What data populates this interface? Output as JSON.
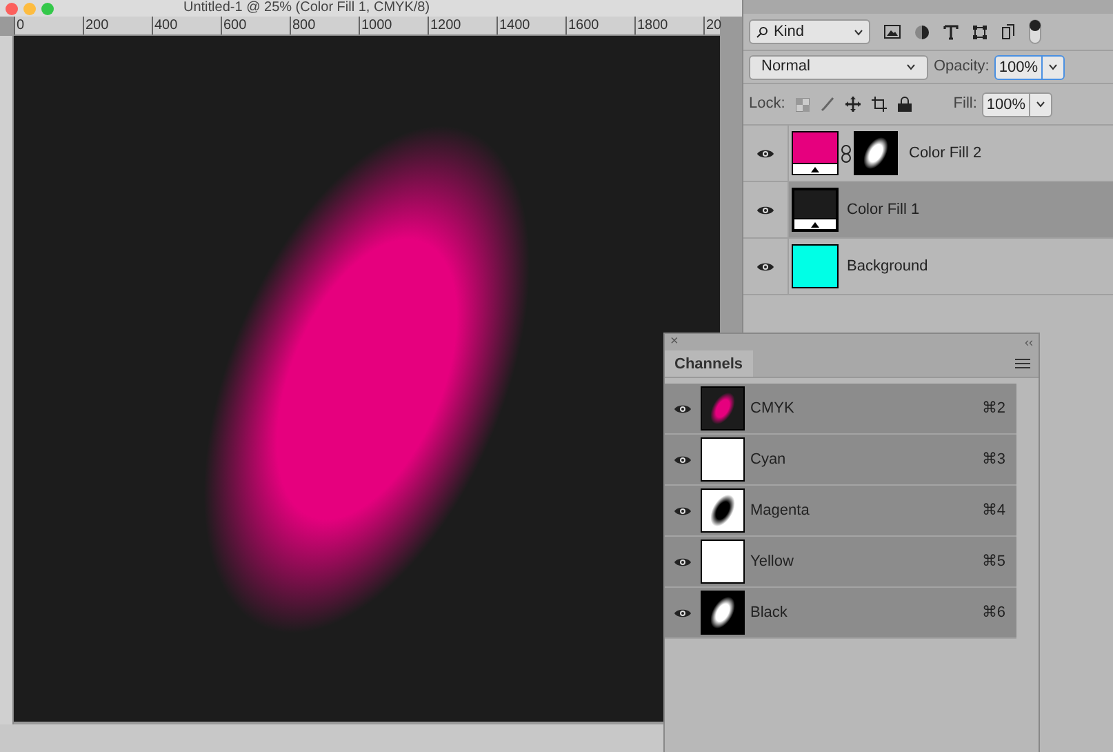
{
  "window": {
    "title": "Untitled-1 @ 25% (Color Fill 1, CMYK/8)"
  },
  "ruler": {
    "labels": [
      "0",
      "200",
      "400",
      "600",
      "800",
      "1000",
      "1200",
      "1400",
      "1600",
      "1800",
      "20"
    ]
  },
  "layers_panel": {
    "filter": "Kind",
    "blend_mode": "Normal",
    "opacity_label": "Opacity:",
    "opacity": "100%",
    "lock_label": "Lock:",
    "fill_label": "Fill:",
    "fill": "100%",
    "layers": [
      {
        "name": "Color Fill 2",
        "kind": "fill_mask",
        "color": "#e6007e",
        "visible": true,
        "selected": false
      },
      {
        "name": "Color Fill 1",
        "kind": "fill",
        "color": "#1c1c1c",
        "visible": true,
        "selected": true
      },
      {
        "name": "Background",
        "kind": "plain",
        "color": "#00ffe6",
        "visible": true,
        "selected": false
      }
    ]
  },
  "channels_panel": {
    "close": "×",
    "collapse": "‹‹",
    "tab": "Channels",
    "channels": [
      {
        "name": "CMYK",
        "shortcut": "⌘2",
        "kind": "composite",
        "visible": true,
        "selected": true
      },
      {
        "name": "Cyan",
        "shortcut": "⌘3",
        "kind": "blank",
        "visible": true,
        "selected": true
      },
      {
        "name": "Magenta",
        "shortcut": "⌘4",
        "kind": "dark_blob",
        "visible": true,
        "selected": true
      },
      {
        "name": "Yellow",
        "shortcut": "⌘5",
        "kind": "blank",
        "visible": true,
        "selected": true
      },
      {
        "name": "Black",
        "shortcut": "⌘6",
        "kind": "light_blob",
        "visible": true,
        "selected": true
      }
    ]
  }
}
